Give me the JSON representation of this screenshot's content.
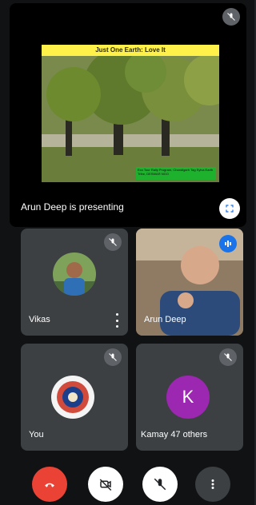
{
  "presentation": {
    "slide_title": "Just One Earth: Love It",
    "slide_caption": "Eco Tour Rally Program, Chandigarh Tag Sylva Earth Tribe, DESWAR NGO",
    "status_text": "Arun Deep is presenting"
  },
  "participants": [
    {
      "name": "Vikas",
      "muted": true
    },
    {
      "name": "Arun Deep",
      "muted": false,
      "speaking": true
    },
    {
      "name": "You",
      "muted": true
    },
    {
      "name": "Kamay",
      "muted": true,
      "avatar_letter": "K"
    }
  ],
  "others_label": "47 others",
  "controls": {
    "end_call_color": "#ea4335"
  }
}
